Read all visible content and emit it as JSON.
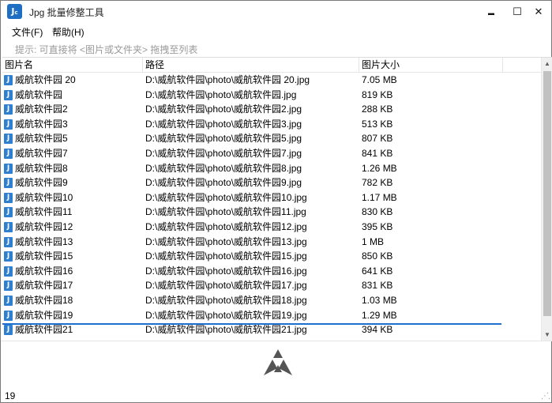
{
  "window": {
    "title": "Jpg 批量修整工具",
    "icon_text": "J​",
    "minimize_glyph": "▬",
    "maximize_glyph": "☐",
    "close_glyph": "✕"
  },
  "menu": {
    "file": "文件(F)",
    "help": "帮助(H)"
  },
  "hint": "提示: 可直接将 <图片或文件夹> 拖拽至列表",
  "columns": {
    "name": "图片名",
    "path": "路径",
    "size": "图片大小"
  },
  "rows": [
    {
      "name": "威航软件园 20",
      "path": "D:\\威航软件园\\photo\\威航软件园 20.jpg",
      "size": "7.05 MB"
    },
    {
      "name": "威航软件园",
      "path": "D:\\威航软件园\\photo\\威航软件园.jpg",
      "size": "819 KB"
    },
    {
      "name": "威航软件园2",
      "path": "D:\\威航软件园\\photo\\威航软件园2.jpg",
      "size": "288 KB"
    },
    {
      "name": "威航软件园3",
      "path": "D:\\威航软件园\\photo\\威航软件园3.jpg",
      "size": "513 KB"
    },
    {
      "name": "威航软件园5",
      "path": "D:\\威航软件园\\photo\\威航软件园5.jpg",
      "size": "807 KB"
    },
    {
      "name": "威航软件园7",
      "path": "D:\\威航软件园\\photo\\威航软件园7.jpg",
      "size": "841 KB"
    },
    {
      "name": "威航软件园8",
      "path": "D:\\威航软件园\\photo\\威航软件园8.jpg",
      "size": "1.26 MB"
    },
    {
      "name": "威航软件园9",
      "path": "D:\\威航软件园\\photo\\威航软件园9.jpg",
      "size": "782 KB"
    },
    {
      "name": "威航软件园10",
      "path": "D:\\威航软件园\\photo\\威航软件园10.jpg",
      "size": "1.17 MB"
    },
    {
      "name": "威航软件园11",
      "path": "D:\\威航软件园\\photo\\威航软件园11.jpg",
      "size": "830 KB"
    },
    {
      "name": "威航软件园12",
      "path": "D:\\威航软件园\\photo\\威航软件园12.jpg",
      "size": "395 KB"
    },
    {
      "name": "威航软件园13",
      "path": "D:\\威航软件园\\photo\\威航软件园13.jpg",
      "size": "1 MB"
    },
    {
      "name": "威航软件园15",
      "path": "D:\\威航软件园\\photo\\威航软件园15.jpg",
      "size": "850 KB"
    },
    {
      "name": "威航软件园16",
      "path": "D:\\威航软件园\\photo\\威航软件园16.jpg",
      "size": "641 KB"
    },
    {
      "name": "威航软件园17",
      "path": "D:\\威航软件园\\photo\\威航软件园17.jpg",
      "size": "831 KB"
    },
    {
      "name": "威航软件园18",
      "path": "D:\\威航软件园\\photo\\威航软件园18.jpg",
      "size": "1.03 MB"
    },
    {
      "name": "威航软件园19",
      "path": "D:\\威航软件园\\photo\\威航软件园19.jpg",
      "size": "1.29 MB"
    },
    {
      "name": "威航软件园21",
      "path": "D:\\威航软件园\\photo\\威航软件园21.jpg",
      "size": "394 KB"
    }
  ],
  "row_icon_text": "J",
  "status": {
    "count": "19"
  },
  "colors": {
    "accent": "#1e6fc4",
    "file_icon": "#2f7fd1",
    "hint_text": "#9a9a9a",
    "logo": "#555555"
  },
  "icons": {
    "app": "jpg-tool-icon",
    "file": "jpg-file-icon",
    "logo": "triangle-logo-icon"
  }
}
